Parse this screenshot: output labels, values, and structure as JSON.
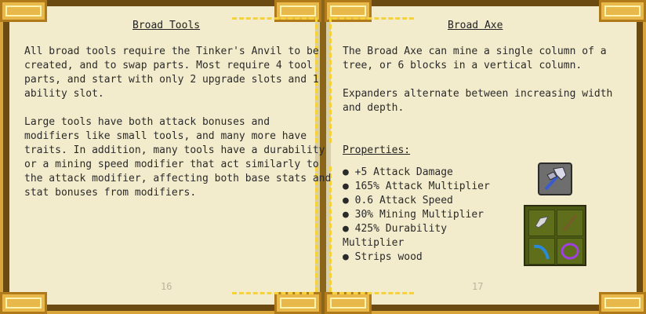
{
  "left_page": {
    "title": "Broad Tools",
    "paragraph1": "All broad tools require the Tinker's Anvil to be\ncreated, and to swap parts. Most require 4 tool\nparts, and start with only 2 upgrade slots and 1\nability slot.",
    "paragraph2": "Large tools have both attack bonuses and\nmodifiers like small tools, and many more have\ntraits. In addition, many tools have a durability\nor a mining speed modifier that act similarly to\nthe attack modifier, affecting both base stats and\nstat bonuses from modifiers.",
    "page_number": "16"
  },
  "right_page": {
    "title": "Broad Axe",
    "paragraph1": "The Broad Axe can mine a single column of a\ntree, or 6 blocks in a vertical column.",
    "paragraph2": "Expanders alternate between increasing width\nand depth.",
    "properties_heading": "Properties:",
    "properties": [
      "● +5 Attack Damage",
      "● 165% Attack Multiplier",
      "● 0.6 Attack Speed",
      "● 30% Mining Multiplier",
      "● 425% Durability\nMultiplier",
      "● Strips wood"
    ],
    "page_number": "17"
  },
  "icons": {
    "tool": "broad-axe-icon",
    "parts": [
      "axe-head-icon",
      "tool-rod-icon",
      "plate-icon",
      "binding-icon"
    ]
  },
  "colors": {
    "page": "#f3eccc",
    "frame": "#d9a43a",
    "trim": "#f5d23a",
    "text": "#2a2a2a"
  }
}
